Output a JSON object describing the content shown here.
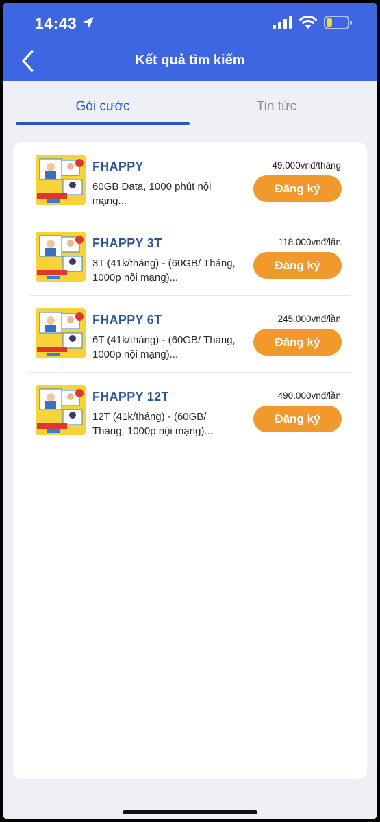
{
  "status_bar": {
    "time": "14:43"
  },
  "nav": {
    "title": "Kết quả tìm kiếm"
  },
  "tabs": [
    {
      "label": "Gói cước",
      "active": true
    },
    {
      "label": "Tin tức",
      "active": false
    }
  ],
  "packages": [
    {
      "name": "FHAPPY",
      "description": "60GB Data, 1000 phút nội mạng...",
      "price": "49.000vnđ/tháng",
      "button": "Đăng ký"
    },
    {
      "name": "FHAPPY 3T",
      "description": "3T (41k/tháng) - (60GB/ Tháng, 1000p nội mạng)...",
      "price": "118.000vnđ/lần",
      "button": "Đăng ký"
    },
    {
      "name": "FHAPPY 6T",
      "description": "6T (41k/tháng) - (60GB/ Tháng, 1000p nội mạng)...",
      "price": "245.000vnđ/lần",
      "button": "Đăng ký"
    },
    {
      "name": "FHAPPY 12T",
      "description": "12T (41k/tháng) - (60GB/ Tháng, 1000p nội mạng)...",
      "price": "490.000vnđ/lần",
      "button": "Đăng ký"
    }
  ],
  "colors": {
    "header": "#3d66e0",
    "tab_active": "#2a5bbd",
    "button": "#f2992e",
    "package_name": "#2b5597"
  }
}
